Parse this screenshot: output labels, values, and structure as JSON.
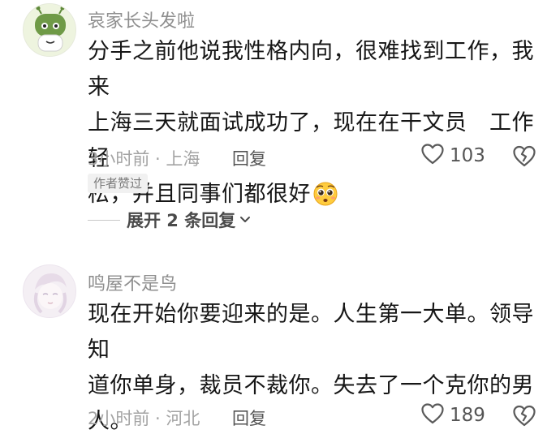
{
  "comments": [
    {
      "username": "哀家长头发啦",
      "text_line1": "分手之前他说我性格内向，很难找到工作，我来",
      "text_line2": "上海三天就面试成功了，现在在干文员　工作轻",
      "text_line3": "松，并且同事们都很好",
      "emoji": "pleading-face-emoji",
      "meta": "3小时前 · 上海",
      "reply_label": "回复",
      "like_count": "103",
      "author_badge": "作者赞过",
      "expand_label": "展开 2 条回复"
    },
    {
      "username": "鸣屋不是鸟",
      "text_line1": "现在开始你要迎来的是。人生第一大单。领导知",
      "text_line2": "道你单身，裁员不裁你。失去了一个克你的男",
      "text_line3": "人。",
      "meta": "2小时前 · 河北",
      "reply_label": "回复",
      "like_count": "189"
    }
  ],
  "colors": {
    "username": "#8f8f8f",
    "body": "#161616",
    "meta": "#a3a3a3",
    "badge_bg": "#f1f1f1"
  },
  "icons": [
    "heart-outline-icon",
    "broken-heart-icon",
    "chevron-down-icon"
  ]
}
